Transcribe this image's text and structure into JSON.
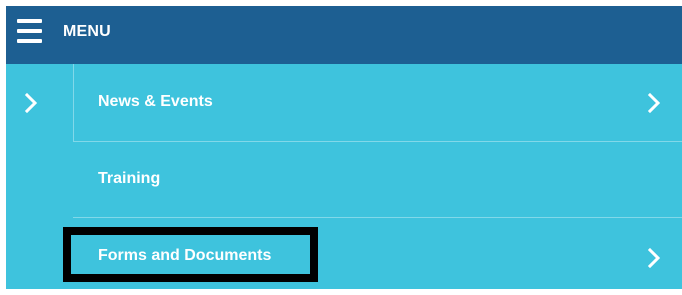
{
  "header": {
    "menu_label": "MENU",
    "menu_icon": "hamburger-icon",
    "background": "#1d5f92"
  },
  "menu": {
    "background": "#3ec3dd",
    "items": [
      {
        "label": "News & Events",
        "expand_icon": "chevron-right-icon",
        "submenu_icon": "chevron-right-icon"
      },
      {
        "label": "Training"
      },
      {
        "label": "Forms and Documents",
        "submenu_icon": "chevron-right-icon",
        "highlighted": true
      }
    ]
  }
}
